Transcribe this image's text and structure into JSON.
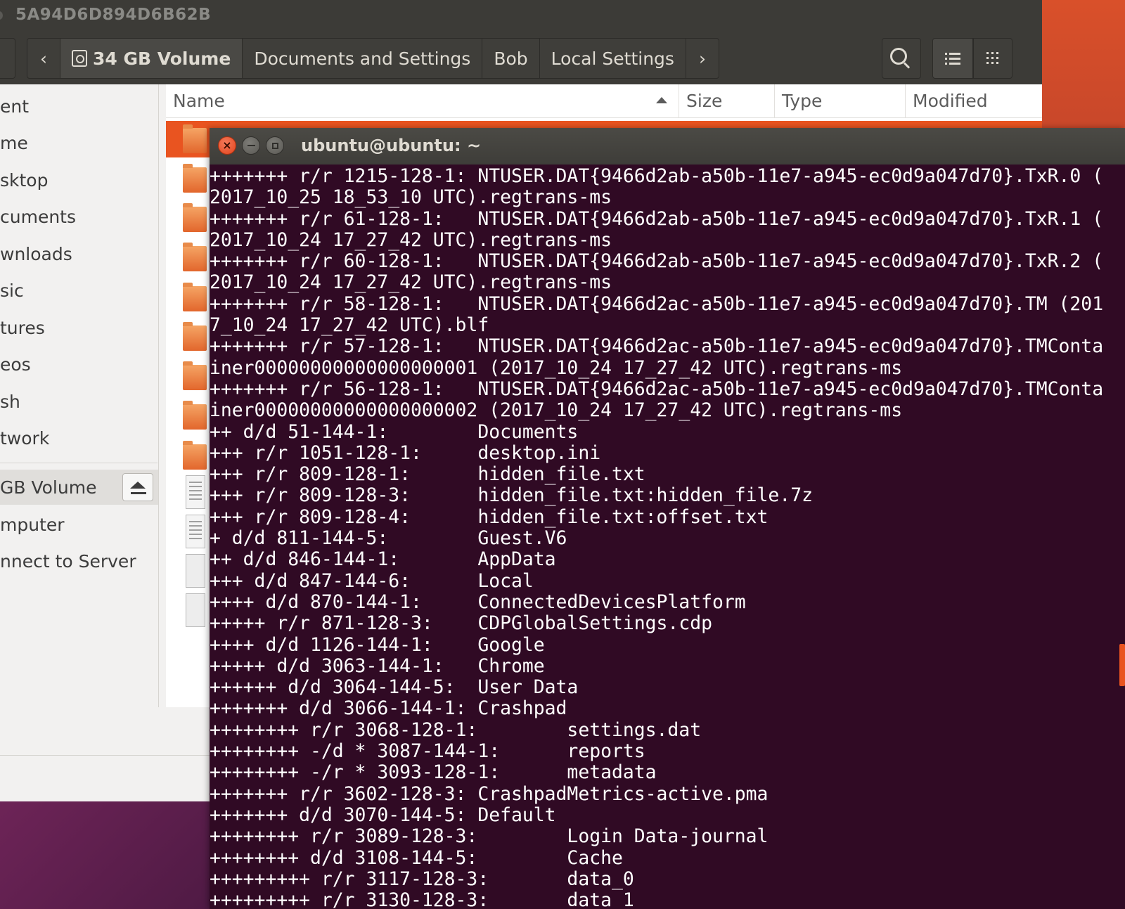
{
  "file_manager": {
    "window_title": "5A94D6D894D6B62B",
    "pathbar": {
      "back": "‹",
      "crumbs": [
        "34 GB Volume",
        "Documents and Settings",
        "Bob",
        "Local Settings"
      ],
      "forward": "›"
    },
    "sidebar": {
      "items": [
        "ent",
        "me",
        "sktop",
        "cuments",
        "wnloads",
        "sic",
        "tures",
        "eos",
        "sh",
        "twork"
      ],
      "devices": [
        "GB Volume",
        "mputer",
        "nnect to Server"
      ]
    },
    "columns": {
      "name": "Name",
      "size": "Size",
      "type": "Type",
      "modified": "Modified"
    }
  },
  "terminal": {
    "title": "ubuntu@ubuntu: ~",
    "lines": [
      "+++++++ r/r 1215-128-1: NTUSER.DAT{9466d2ab-a50b-11e7-a945-ec0d9a047d70}.TxR.0 (",
      "2017_10_25 18_53_10 UTC).regtrans-ms",
      "+++++++ r/r 61-128-1:   NTUSER.DAT{9466d2ab-a50b-11e7-a945-ec0d9a047d70}.TxR.1 (",
      "2017_10_24 17_27_42 UTC).regtrans-ms",
      "+++++++ r/r 60-128-1:   NTUSER.DAT{9466d2ab-a50b-11e7-a945-ec0d9a047d70}.TxR.2 (",
      "2017_10_24 17_27_42 UTC).regtrans-ms",
      "+++++++ r/r 58-128-1:   NTUSER.DAT{9466d2ac-a50b-11e7-a945-ec0d9a047d70}.TM (201",
      "7_10_24 17_27_42 UTC).blf",
      "+++++++ r/r 57-128-1:   NTUSER.DAT{9466d2ac-a50b-11e7-a945-ec0d9a047d70}.TMConta",
      "iner00000000000000000001 (2017_10_24 17_27_42 UTC).regtrans-ms",
      "+++++++ r/r 56-128-1:   NTUSER.DAT{9466d2ac-a50b-11e7-a945-ec0d9a047d70}.TMConta",
      "iner00000000000000000002 (2017_10_24 17_27_42 UTC).regtrans-ms",
      "++ d/d 51-144-1:        Documents",
      "+++ r/r 1051-128-1:     desktop.ini",
      "+++ r/r 809-128-1:      hidden_file.txt",
      "+++ r/r 809-128-3:      hidden_file.txt:hidden_file.7z",
      "+++ r/r 809-128-4:      hidden_file.txt:offset.txt",
      "+ d/d 811-144-5:        Guest.V6",
      "++ d/d 846-144-1:       AppData",
      "+++ d/d 847-144-6:      Local",
      "++++ d/d 870-144-1:     ConnectedDevicesPlatform",
      "+++++ r/r 871-128-3:    CDPGlobalSettings.cdp",
      "++++ d/d 1126-144-1:    Google",
      "+++++ d/d 3063-144-1:   Chrome",
      "++++++ d/d 3064-144-5:  User Data",
      "+++++++ d/d 3066-144-1: Crashpad",
      "++++++++ r/r 3068-128-1:        settings.dat",
      "++++++++ -/d * 3087-144-1:      reports",
      "++++++++ -/r * 3093-128-1:      metadata",
      "+++++++ r/r 3602-128-3: CrashpadMetrics-active.pma",
      "+++++++ d/d 3070-144-5: Default",
      "++++++++ r/r 3089-128-3:        Login Data-journal",
      "++++++++ d/d 3108-144-5:        Cache",
      "+++++++++ r/r 3117-128-3:       data_0",
      "+++++++++ r/r 3130-128-3:       data_1"
    ]
  },
  "colors": {
    "terminal_bg": "#300a24",
    "accent": "#e95420",
    "titlebar": "#3c3b37"
  }
}
